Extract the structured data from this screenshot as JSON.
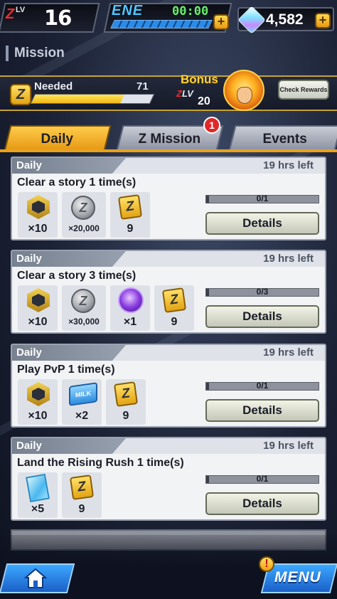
{
  "player": {
    "zlv_prefix": "Z",
    "lv_label": "LV",
    "level": "16"
  },
  "energy": {
    "label": "ENE",
    "timer": "00:00",
    "fill_fraction": 1.0
  },
  "currency": {
    "amount": "4,582",
    "icon": "chrono-crystal-icon"
  },
  "screen_title": "Mission",
  "bonus_band": {
    "needed_label": "Needed",
    "needed_value": "71",
    "needed_fill_fraction": 0.75,
    "bonus_label": "Bonus",
    "bonus_zlv_prefix": "Z",
    "bonus_lv_label": "LV",
    "bonus_level": "20",
    "check_rewards_label": "Check Rewards"
  },
  "tabs": [
    {
      "label": "Daily",
      "active": true
    },
    {
      "label": "Z Mission",
      "active": false,
      "badge": "1"
    },
    {
      "label": "Events",
      "active": false
    }
  ],
  "missions": [
    {
      "category": "Daily",
      "time_left": "19 hrs left",
      "title": "Clear a story 1 time(s)",
      "rewards": [
        {
          "icon": "medal-icon",
          "qty": "×10"
        },
        {
          "icon": "zeni-coin-icon",
          "qty": "×20,000"
        },
        {
          "icon": "z-medal-icon",
          "qty": "9"
        }
      ],
      "progress": "0/1",
      "details_label": "Details"
    },
    {
      "category": "Daily",
      "time_left": "19 hrs left",
      "title": "Clear a story 3 time(s)",
      "rewards": [
        {
          "icon": "medal-icon",
          "qty": "×10"
        },
        {
          "icon": "zeni-coin-icon",
          "qty": "×30,000"
        },
        {
          "icon": "purple-orb-icon",
          "qty": "×1"
        },
        {
          "icon": "z-medal-icon",
          "qty": "9"
        }
      ],
      "progress": "0/3",
      "details_label": "Details"
    },
    {
      "category": "Daily",
      "time_left": "19 hrs left",
      "title": "Play PvP 1 time(s)",
      "rewards": [
        {
          "icon": "medal-icon",
          "qty": "×10"
        },
        {
          "icon": "milk-crate-icon",
          "qty": "×2",
          "icon_text": "MILK"
        },
        {
          "icon": "z-medal-icon",
          "qty": "9"
        }
      ],
      "progress": "0/1",
      "details_label": "Details"
    },
    {
      "category": "Daily",
      "time_left": "19 hrs left",
      "title": "Land the Rising Rush 1 time(s)",
      "rewards": [
        {
          "icon": "ticket-icon",
          "qty": "×5"
        },
        {
          "icon": "z-medal-icon",
          "qty": "9"
        }
      ],
      "progress": "0/1",
      "details_label": "Details"
    }
  ],
  "bottom_nav": {
    "menu_label": "MENU",
    "menu_alert": "!"
  }
}
